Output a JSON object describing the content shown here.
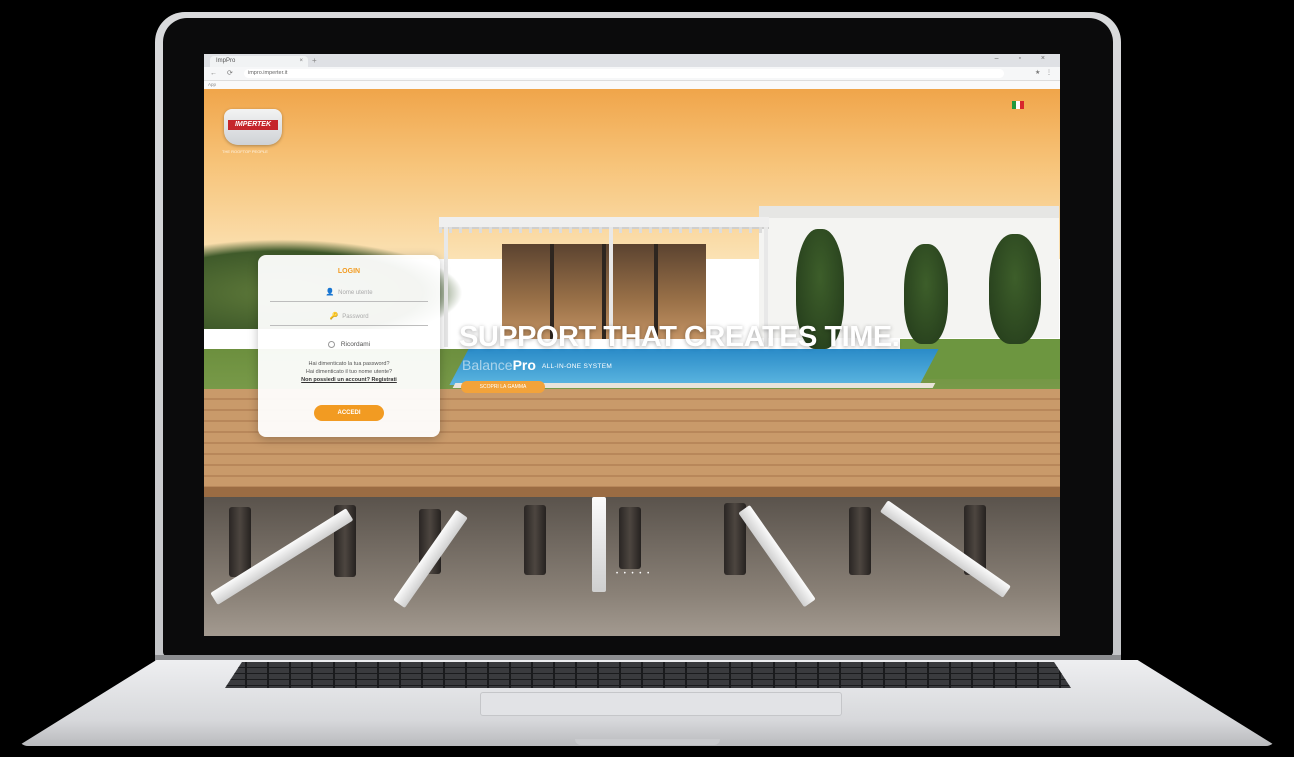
{
  "browser": {
    "tab_title": "ImpPro",
    "tab_close": "×",
    "new_tab": "+",
    "window_controls": "– ▫ ×",
    "nav_buttons": "← ⟳",
    "url": "impro.imperter.it",
    "extensions": "★ ⋮",
    "bookmarks": "App"
  },
  "site": {
    "logo_text": "IMPERTEK",
    "logo_tagline": "THE ROOFTOP PEOPLE",
    "language_flag": "Italian",
    "login": {
      "title": "LOGIN",
      "username_placeholder": "Nome utente",
      "password_placeholder": "Password",
      "remember": "Ricordami",
      "help_line1": "Hai dimenticato la tua password?",
      "help_line2": "Hai dimenticato il tuo nome utente?",
      "register": "Non possiedi un account? Registrati",
      "submit": "ACCEDI"
    },
    "hero": {
      "headline": "SUPPORT THAT CREATES TIME.",
      "product_light": "Balance",
      "product_bold": "Pro",
      "product_tagline": "ALL-IN-ONE SYSTEM",
      "cta": "SCOPRI LA GAMMA",
      "slider_dots": "• • • • •"
    }
  },
  "colors": {
    "accent": "#f29b22",
    "brand_red": "#c5262b"
  }
}
